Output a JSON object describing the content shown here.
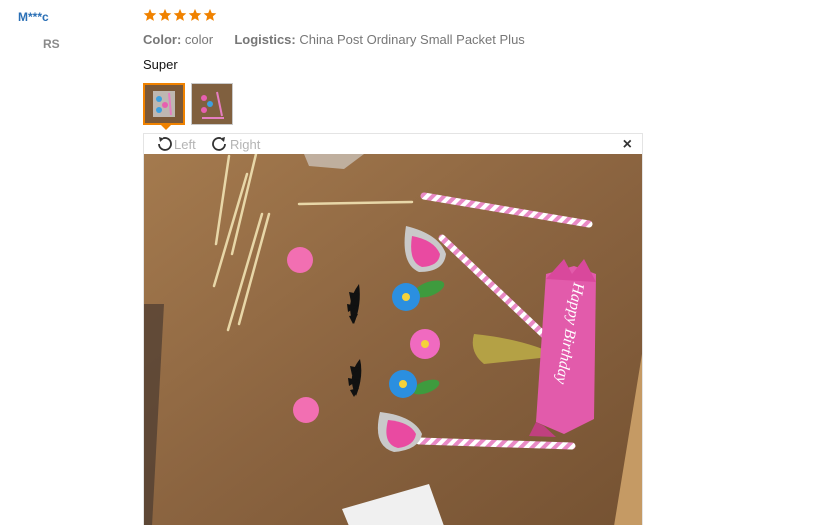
{
  "reviewer": {
    "name": "M***c",
    "country": "RS"
  },
  "review": {
    "rating": 5,
    "rating_max": 5,
    "star_color": "#f08200",
    "color_label": "Color:",
    "color_value": "color",
    "logistics_label": "Logistics:",
    "logistics_value": "China Post Ordinary Small Packet Plus",
    "text": "Super"
  },
  "viewer": {
    "rotate_left_label": "Left",
    "rotate_right_label": "Right",
    "close_label": "×"
  },
  "photo": {
    "banner_text": "Happy Birthday"
  }
}
